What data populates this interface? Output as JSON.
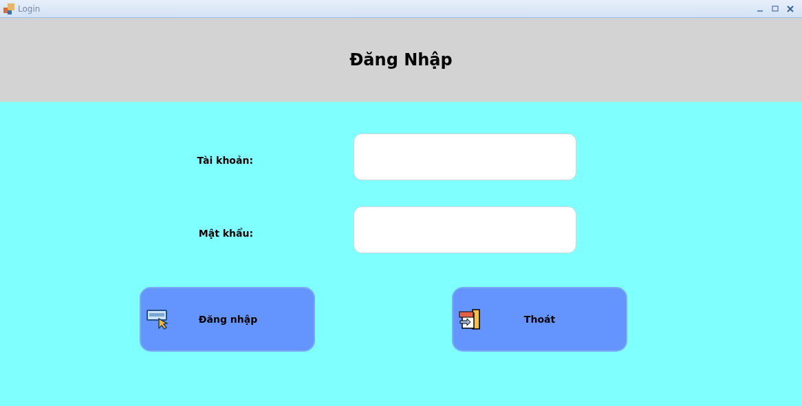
{
  "window": {
    "title": "Login"
  },
  "header": {
    "title": "Đăng Nhập"
  },
  "fields": [
    {
      "label": "Tài khoản:"
    },
    {
      "label": "Mật khẩu:"
    }
  ],
  "buttons": [
    {
      "kind": "signin",
      "label": "Đăng nhập"
    },
    {
      "kind": "exit",
      "label": "Thoát"
    }
  ]
}
